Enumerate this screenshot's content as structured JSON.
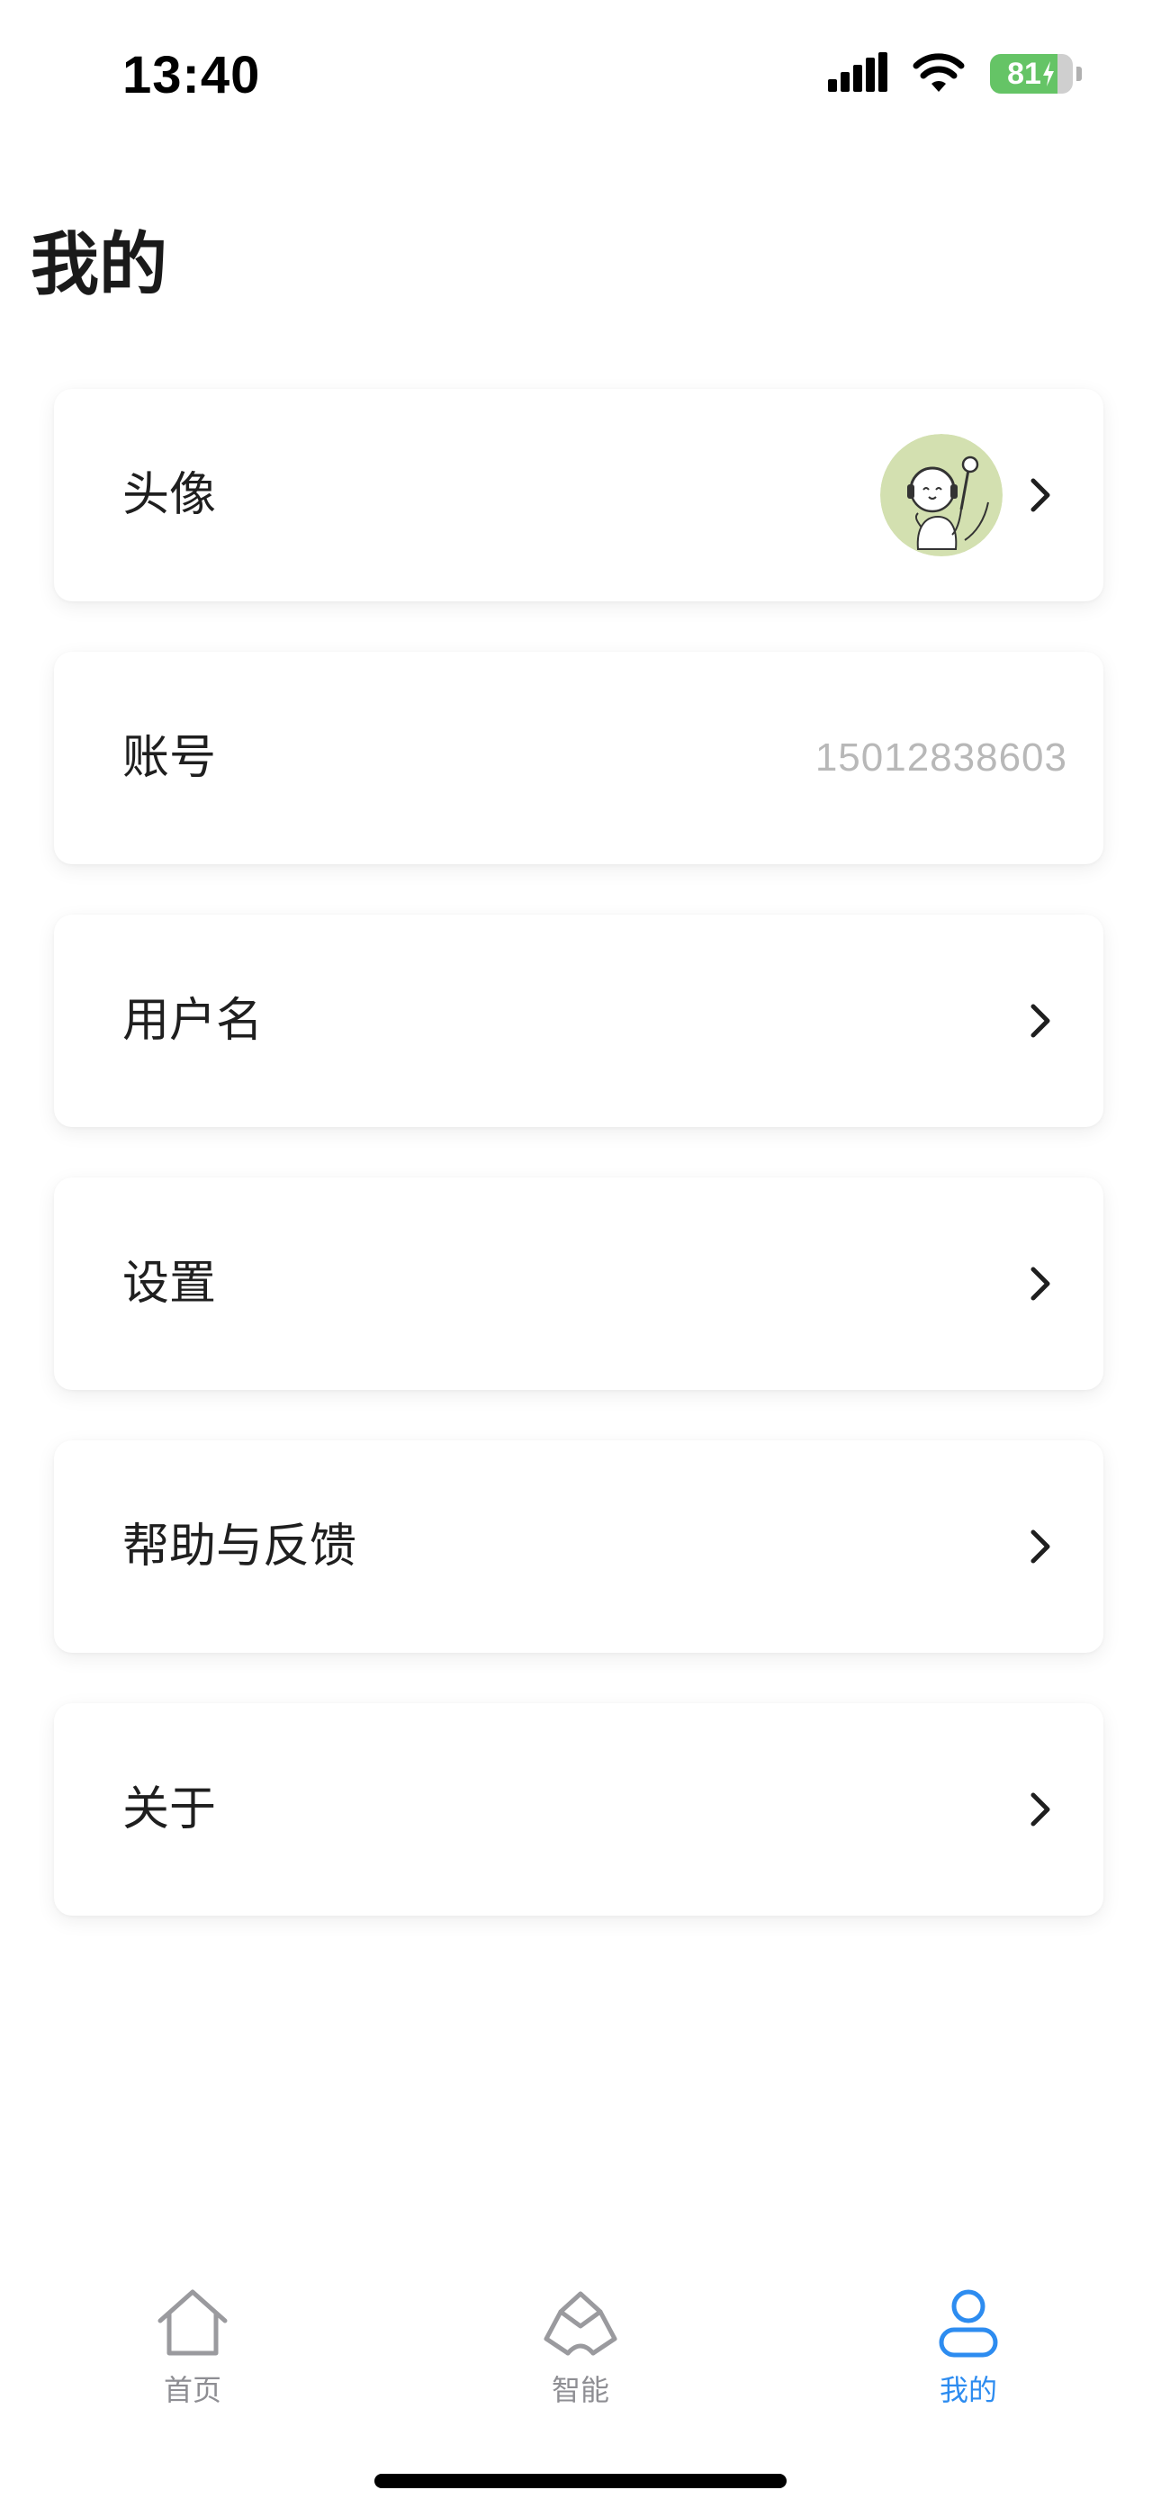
{
  "status_bar": {
    "time": "13:40",
    "battery_level": "81",
    "battery_color": "#65c466"
  },
  "page": {
    "title": "我的"
  },
  "menu": {
    "avatar_label": "头像",
    "account_label": "账号",
    "account_value": "15012838603",
    "username_label": "用户名",
    "settings_label": "设置",
    "help_label": "帮助与反馈",
    "about_label": "关于",
    "chevron_icon": "chevron-right-icon"
  },
  "tab_bar": {
    "home_label": "首页",
    "smart_label": "智能",
    "mine_label": "我的",
    "active_tab": "mine",
    "active_color": "#2d8cf0",
    "inactive_color": "#8e8e93"
  }
}
